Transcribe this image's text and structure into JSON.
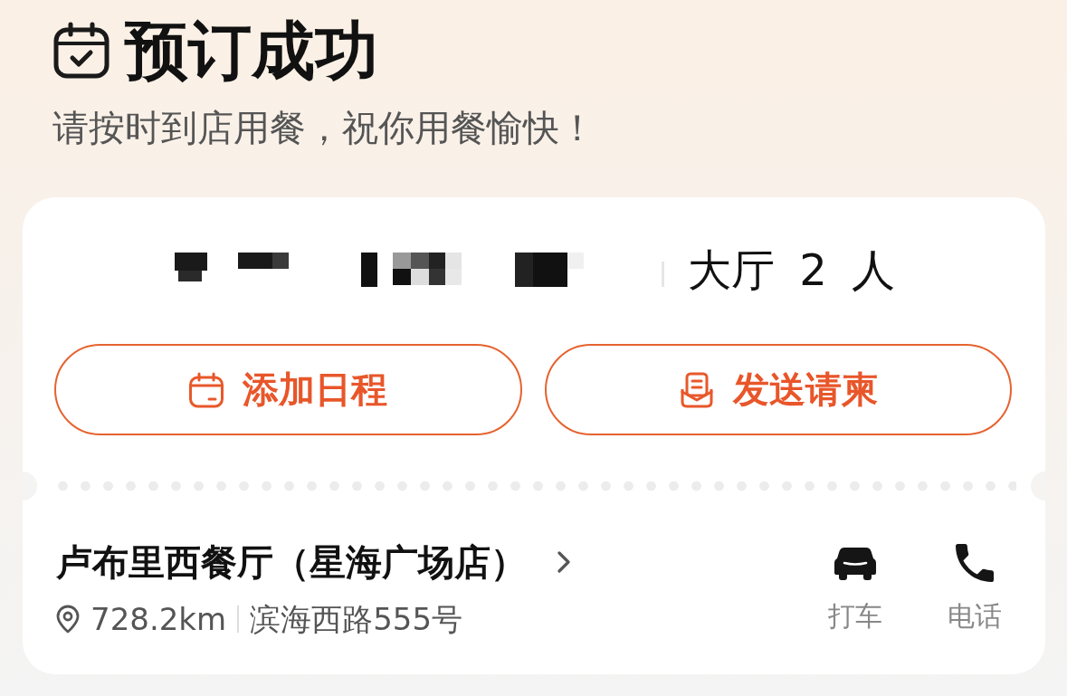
{
  "header": {
    "title": "预订成功",
    "subtitle": "请按时到店用餐，祝你用餐愉快！"
  },
  "booking": {
    "seating": "大厅 2 人"
  },
  "actions": [
    {
      "kind": "calendar",
      "label": "添加日程"
    },
    {
      "kind": "invitation",
      "label": "发送请柬"
    }
  ],
  "restaurant": {
    "name": "卢布里西餐厅（星海广场店）",
    "distance": "728.2km",
    "address": "滨海西路555号"
  },
  "contact_actions": [
    {
      "kind": "taxi",
      "label": "打车"
    },
    {
      "kind": "phone",
      "label": "电话"
    }
  ]
}
